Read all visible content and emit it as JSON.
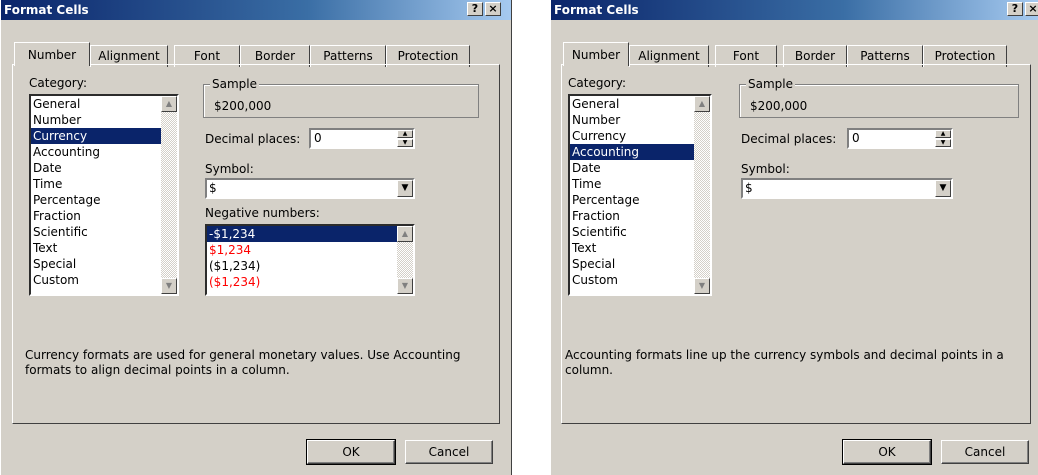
{
  "left": {
    "title": "Format Cells",
    "help_button": "?",
    "close_button": "×",
    "tabs": [
      "Number",
      "Alignment",
      "Font",
      "Border",
      "Patterns",
      "Protection"
    ],
    "category_label": "Category:",
    "categories": [
      "General",
      "Number",
      "Currency",
      "Accounting",
      "Date",
      "Time",
      "Percentage",
      "Fraction",
      "Scientific",
      "Text",
      "Special",
      "Custom"
    ],
    "selected_category": "Currency",
    "sample_label": "Sample",
    "sample_value": "$200,000",
    "decimal_label": "Decimal places:",
    "decimal_value": "0",
    "symbol_label": "Symbol:",
    "symbol_value": "$",
    "negative_label": "Negative numbers:",
    "negative_items": [
      "-$1,234",
      "$1,234",
      "($1,234)",
      "($1,234)"
    ],
    "description": "Currency formats are used for general monetary values.  Use Accounting formats to align decimal points in a column.",
    "ok_label": "OK",
    "cancel_label": "Cancel"
  },
  "right": {
    "title": "Format Cells",
    "help_button": "?",
    "close_button": "×",
    "tabs": [
      "Number",
      "Alignment",
      "Font",
      "Border",
      "Patterns",
      "Protection"
    ],
    "category_label": "Category:",
    "categories": [
      "General",
      "Number",
      "Currency",
      "Accounting",
      "Date",
      "Time",
      "Percentage",
      "Fraction",
      "Scientific",
      "Text",
      "Special",
      "Custom"
    ],
    "selected_category": "Accounting",
    "sample_label": "Sample",
    "sample_value": "$200,000",
    "decimal_label": "Decimal places:",
    "decimal_value": "0",
    "symbol_label": "Symbol:",
    "symbol_value": "$",
    "description": "Accounting formats line up the currency symbols and decimal points in a column.",
    "ok_label": "OK",
    "cancel_label": "Cancel"
  },
  "colors": {
    "titlebar": "#0a246a",
    "dialog_face": "#d4d0c8",
    "selection": "#0a246a",
    "negative_red": "#ff0000"
  }
}
